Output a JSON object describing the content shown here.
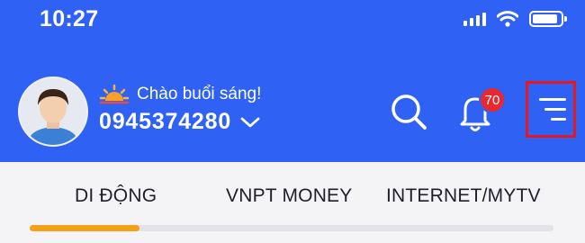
{
  "status_bar": {
    "time": "10:27",
    "icons": [
      "signal-icon",
      "wifi-icon",
      "battery-icon"
    ]
  },
  "header": {
    "greeting": "Chào buổi sáng!",
    "greeting_icon": "sunrise-icon",
    "phone_number": "0945374280",
    "notification_count": "70",
    "background_color": "#2f61f5",
    "badge_color": "#e8282f"
  },
  "tabs": {
    "items": [
      {
        "label": "DI ĐỘNG"
      },
      {
        "label": "VNPT MONEY"
      },
      {
        "label": "INTERNET/MYTV"
      }
    ],
    "active_index": 0,
    "indicator_color": "#f5a117",
    "scroll_progress": 0.21
  }
}
